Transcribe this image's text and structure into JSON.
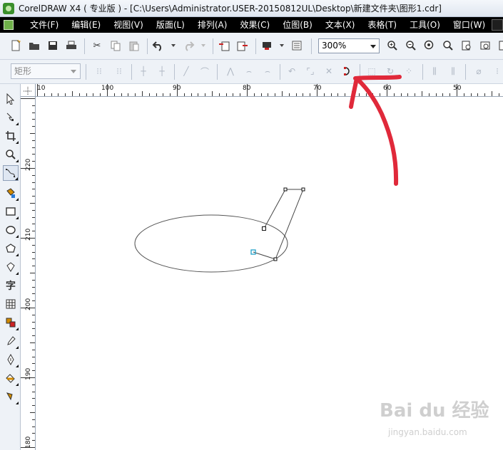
{
  "window": {
    "title": "CorelDRAW X4 ( 专业版 ) - [C:\\Users\\Administrator.USER-20150812UL\\Desktop\\新建文件夹\\图形1.cdr]"
  },
  "menu": {
    "items": [
      "文件(F)",
      "编辑(E)",
      "视图(V)",
      "版面(L)",
      "排列(A)",
      "效果(C)",
      "位图(B)",
      "文本(X)",
      "表格(T)",
      "工具(O)",
      "窗口(W)"
    ]
  },
  "toolbar": {
    "zoom_value": "300%"
  },
  "property_bar": {
    "shape_selector_value": "矩形"
  },
  "rulers": {
    "top_labels": [
      "10",
      "100",
      "90",
      "80",
      "70",
      "60",
      "50"
    ],
    "left_labels": [
      "220",
      "210",
      "200",
      "190",
      "180"
    ]
  },
  "colors": {
    "menubar_bg": "#000000",
    "annotation_arrow": "#e0293a",
    "node_highlight": "#1fa0c8"
  },
  "watermark": {
    "brand": "Bai du 经验",
    "url": "jingyan.baidu.com"
  }
}
